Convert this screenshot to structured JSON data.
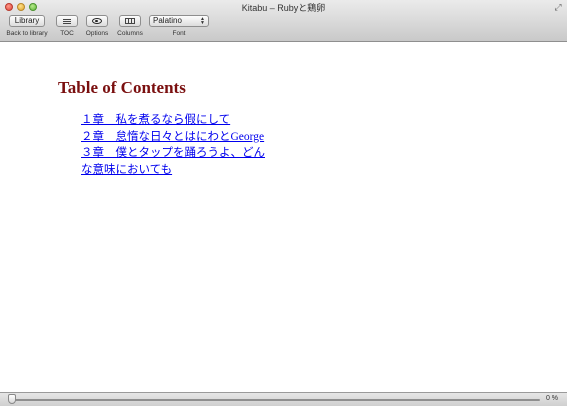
{
  "window": {
    "title": "Kitabu – Rubyと鶏卵"
  },
  "toolbar": {
    "library_button": "Library",
    "library_label": "Back to library",
    "toc_label": "TOC",
    "options_label": "Options",
    "columns_label": "Columns",
    "font_value": "Palatino",
    "font_label": "Font"
  },
  "content": {
    "heading": "Table of Contents",
    "chapters": [
      "１章　私を煮るなら假にして",
      "２章　怠惰な日々とはにわとGeorge",
      "３章　僕とタップを踊ろうよ、どん",
      "な意味においても"
    ]
  },
  "progress": {
    "percent_text": "0 %",
    "value": 0
  }
}
